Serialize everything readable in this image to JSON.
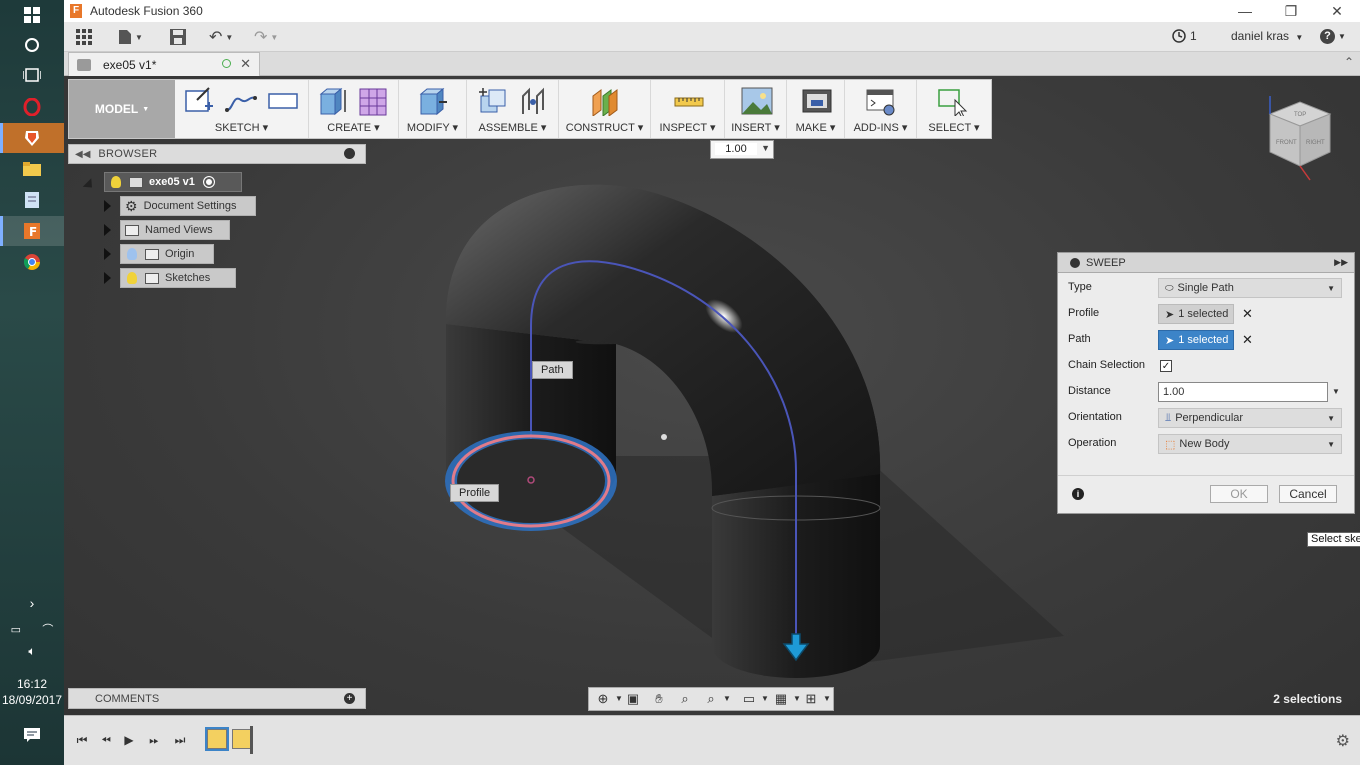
{
  "window": {
    "title": "Autodesk Fusion 360",
    "app_letter": "F"
  },
  "qat": {
    "job_count": "1",
    "user": "daniel kras",
    "help": "?"
  },
  "document_tab": {
    "title": "exe05 v1*"
  },
  "toolbar": {
    "workspace": "MODEL",
    "groups": [
      "SKETCH",
      "CREATE",
      "MODIFY",
      "ASSEMBLE",
      "CONSTRUCT",
      "INSPECT",
      "INSERT",
      "MAKE",
      "ADD-INS",
      "SELECT"
    ]
  },
  "value_box": {
    "value": "1.00"
  },
  "browser": {
    "header": "BROWSER",
    "root": "exe05 v1",
    "items": [
      "Document Settings",
      "Named Views",
      "Origin",
      "Sketches"
    ]
  },
  "comments": {
    "label": "COMMENTS"
  },
  "viewport_labels": {
    "path": "Path",
    "profile": "Profile"
  },
  "viewcube": {
    "top": "TOP",
    "front": "FRONT",
    "right": "RIGHT"
  },
  "status": {
    "selections": "2 selections"
  },
  "sweep": {
    "title": "SWEEP",
    "type_label": "Type",
    "type_value": "Single Path",
    "profile_label": "Profile",
    "profile_value": "1 selected",
    "path_label": "Path",
    "path_value": "1 selected",
    "chain_label": "Chain Selection",
    "distance_label": "Distance",
    "distance_value": "1.00",
    "orientation_label": "Orientation",
    "orientation_value": "Perpendicular",
    "operation_label": "Operation",
    "operation_value": "New Body",
    "ok": "OK",
    "cancel": "Cancel"
  },
  "tooltip": "Select ske",
  "taskbar": {
    "time": "16:12",
    "date": "18/09/2017"
  }
}
